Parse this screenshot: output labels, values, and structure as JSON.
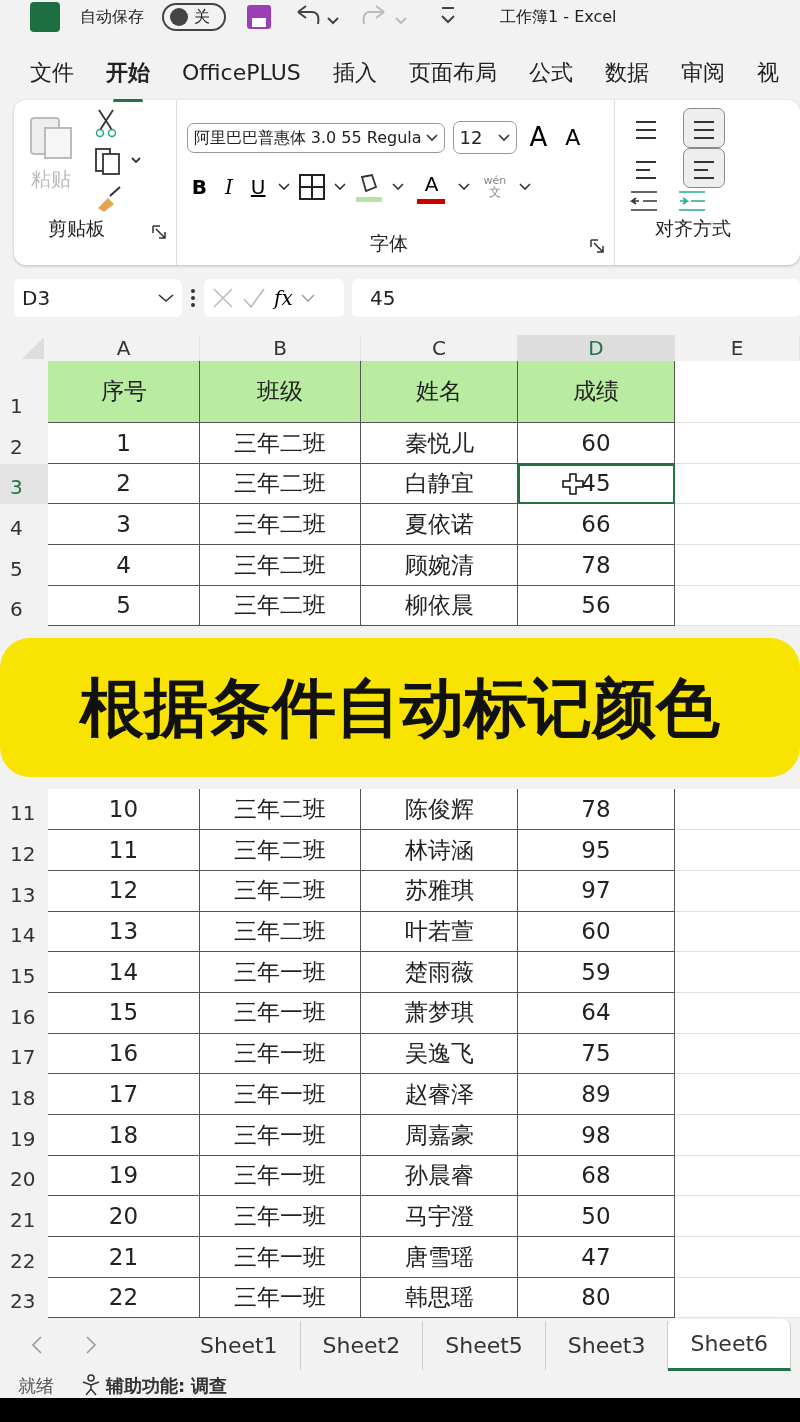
{
  "title_bar": {
    "autosave_label": "自动保存",
    "autosave_toggle": {
      "label": "关",
      "on": false
    },
    "title": "工作簿1  -  Excel"
  },
  "ribbon_tabs": [
    {
      "label": "文件",
      "selected": false
    },
    {
      "label": "开始",
      "selected": true
    },
    {
      "label": "OfficePLUS",
      "selected": false
    },
    {
      "label": "插入",
      "selected": false
    },
    {
      "label": "页面布局",
      "selected": false
    },
    {
      "label": "公式",
      "selected": false
    },
    {
      "label": "数据",
      "selected": false
    },
    {
      "label": "审阅",
      "selected": false
    },
    {
      "label": "视",
      "selected": false
    }
  ],
  "ribbon": {
    "clipboard": {
      "paste": "粘贴",
      "group_label": "剪贴板"
    },
    "font": {
      "font_name": "阿里巴巴普惠体 3.0 55 Regula",
      "font_size": "12",
      "grow": "A",
      "shrink": "A",
      "bold": "B",
      "italic": "I",
      "underline": "U",
      "font_color": "A",
      "phonetic_top": "wén",
      "phonetic_bottom": "文",
      "group_label": "字体"
    },
    "alignment": {
      "vertical": [
        {
          "selected": false
        },
        {
          "selected": true
        }
      ],
      "horizontal": [
        {
          "selected": false
        },
        {
          "selected": true
        }
      ],
      "group_label": "对齐方式"
    }
  },
  "formula_bar": {
    "name_box": "D3",
    "fx": "fx",
    "value": "45"
  },
  "columns": [
    {
      "label": "A",
      "selected": false
    },
    {
      "label": "B",
      "selected": false
    },
    {
      "label": "C",
      "selected": false
    },
    {
      "label": "D",
      "selected": true
    },
    {
      "label": "E",
      "selected": false
    }
  ],
  "rows": [
    {
      "number": "1",
      "kind": "header",
      "selected": false,
      "cells": [
        "序号",
        "班级",
        "姓名",
        "成绩"
      ]
    },
    {
      "number": "2",
      "kind": "data",
      "selected": false,
      "cells": [
        "1",
        "三年二班",
        "秦悦儿",
        "60"
      ]
    },
    {
      "number": "3",
      "kind": "data",
      "selected": true,
      "cells": [
        "2",
        "三年二班",
        "白静宜",
        "45"
      ]
    },
    {
      "number": "4",
      "kind": "data",
      "selected": false,
      "cells": [
        "3",
        "三年二班",
        "夏依诺",
        "66"
      ]
    },
    {
      "number": "5",
      "kind": "data",
      "selected": false,
      "cells": [
        "4",
        "三年二班",
        "顾婉清",
        "78"
      ]
    },
    {
      "number": "6",
      "kind": "data",
      "selected": false,
      "cells": [
        "5",
        "三年二班",
        "柳依晨",
        "56"
      ]
    },
    {
      "kind": "covered"
    },
    {
      "number": "11",
      "kind": "data",
      "selected": false,
      "cells": [
        "10",
        "三年二班",
        "陈俊辉",
        "78"
      ]
    },
    {
      "number": "12",
      "kind": "data",
      "selected": false,
      "cells": [
        "11",
        "三年二班",
        "林诗涵",
        "95"
      ]
    },
    {
      "number": "13",
      "kind": "data",
      "selected": false,
      "cells": [
        "12",
        "三年二班",
        "苏雅琪",
        "97"
      ]
    },
    {
      "number": "14",
      "kind": "data",
      "selected": false,
      "cells": [
        "13",
        "三年二班",
        "叶若萱",
        "60"
      ]
    },
    {
      "number": "15",
      "kind": "data",
      "selected": false,
      "cells": [
        "14",
        "三年一班",
        "楚雨薇",
        "59"
      ]
    },
    {
      "number": "16",
      "kind": "data",
      "selected": false,
      "cells": [
        "15",
        "三年一班",
        "萧梦琪",
        "64"
      ]
    },
    {
      "number": "17",
      "kind": "data",
      "selected": false,
      "cells": [
        "16",
        "三年一班",
        "吴逸飞",
        "75"
      ]
    },
    {
      "number": "18",
      "kind": "data",
      "selected": false,
      "cells": [
        "17",
        "三年一班",
        "赵睿泽",
        "89"
      ]
    },
    {
      "number": "19",
      "kind": "data",
      "selected": false,
      "cells": [
        "18",
        "三年一班",
        "周嘉豪",
        "98"
      ]
    },
    {
      "number": "20",
      "kind": "data",
      "selected": false,
      "cells": [
        "19",
        "三年一班",
        "孙晨睿",
        "68"
      ]
    },
    {
      "number": "21",
      "kind": "data",
      "selected": false,
      "cells": [
        "20",
        "三年一班",
        "马宇澄",
        "50"
      ]
    },
    {
      "number": "22",
      "kind": "data",
      "selected": false,
      "cells": [
        "21",
        "三年一班",
        "唐雪瑶",
        "47"
      ]
    },
    {
      "number": "23",
      "kind": "data",
      "selected": false,
      "cells": [
        "22",
        "三年一班",
        "韩思瑶",
        "80"
      ]
    }
  ],
  "banner": "根据条件自动标记颜色",
  "sheet_tabs": [
    {
      "label": "Sheet1",
      "selected": false
    },
    {
      "label": "Sheet2",
      "selected": false
    },
    {
      "label": "Sheet5",
      "selected": false
    },
    {
      "label": "Sheet3",
      "selected": false
    },
    {
      "label": "Sheet6",
      "selected": true
    }
  ],
  "status_bar": {
    "ready": "就绪",
    "accessibility": "辅助功能: 调查"
  }
}
